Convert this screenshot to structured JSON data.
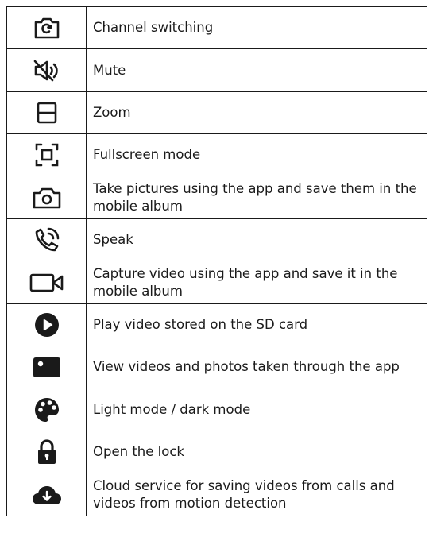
{
  "rows": [
    {
      "icon": "camera-switch-icon",
      "label": "Channel switching"
    },
    {
      "icon": "mute-speaker-icon",
      "label": "Mute"
    },
    {
      "icon": "zoom-split-icon",
      "label": "Zoom"
    },
    {
      "icon": "fullscreen-icon",
      "label": "Fullscreen mode"
    },
    {
      "icon": "camera-icon",
      "label": "Take pictures using the app and save them in the mobile album"
    },
    {
      "icon": "phone-call-icon",
      "label": "Speak"
    },
    {
      "icon": "video-camera-icon",
      "label": "Capture video using the app and save it in the mobile album"
    },
    {
      "icon": "play-circle-icon",
      "label": "Play video stored on the SD card"
    },
    {
      "icon": "gallery-icon",
      "label": "View videos and photos taken through the app"
    },
    {
      "icon": "palette-icon",
      "label": "Light mode / dark mode"
    },
    {
      "icon": "lock-open-icon",
      "label": "Open the lock"
    },
    {
      "icon": "cloud-download-icon",
      "label": "Cloud service for saving videos from calls and videos from motion detection"
    }
  ],
  "colors": {
    "line": "#1a1a1a",
    "icon": "#1a1a1a"
  }
}
